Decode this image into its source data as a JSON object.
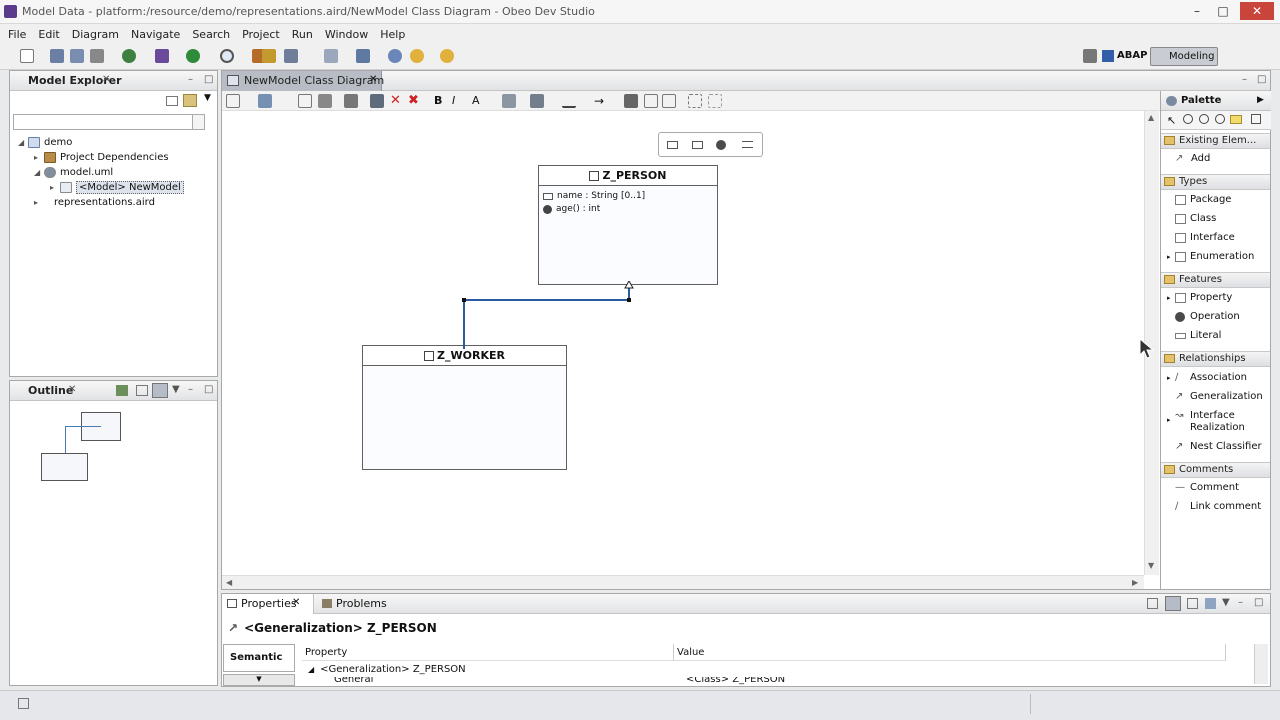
{
  "window": {
    "title": "Model Data - platform:/resource/demo/representations.aird/NewModel Class Diagram - Obeo Dev Studio"
  },
  "menu": [
    "File",
    "Edit",
    "Diagram",
    "Navigate",
    "Search",
    "Project",
    "Run",
    "Window",
    "Help"
  ],
  "perspectives": {
    "abap": "ABAP",
    "modeling": "Modeling"
  },
  "model_explorer": {
    "tab": "Model Explorer",
    "filter_placeholder": "",
    "tree": [
      {
        "label": "demo",
        "level": 0,
        "expanded": true
      },
      {
        "label": "Project Dependencies",
        "level": 1,
        "expanded": false
      },
      {
        "label": "model.uml",
        "level": 1,
        "expanded": true
      },
      {
        "label": "<Model> NewModel",
        "level": 2,
        "expanded": false,
        "selected": true
      },
      {
        "label": "representations.aird",
        "level": 1,
        "expanded": false
      }
    ]
  },
  "outline": {
    "tab": "Outline"
  },
  "editor": {
    "tab": "NewModel Class Diagram"
  },
  "diagram": {
    "person": {
      "title": "Z_PERSON",
      "attribute": "name : String [0..1]",
      "operation": "age() : int"
    },
    "worker": {
      "title": "Z_WORKER"
    }
  },
  "palette": {
    "title": "Palette",
    "sections": [
      {
        "name": "Existing Elem...",
        "items": [
          "Add"
        ]
      },
      {
        "name": "Types",
        "items": [
          "Package",
          "Class",
          "Interface",
          "Enumeration"
        ]
      },
      {
        "name": "Features",
        "items": [
          "Property",
          "Operation",
          "Literal"
        ]
      },
      {
        "name": "Relationships",
        "items": [
          "Association",
          "Generalization",
          "Interface Realization",
          "Nest Classifier"
        ]
      },
      {
        "name": "Comments",
        "items": [
          "Comment",
          "Link comment"
        ]
      }
    ]
  },
  "properties": {
    "tab": "Properties",
    "problems_tab": "Problems",
    "heading": "<Generalization> Z_PERSON",
    "side_tab": "Semantic",
    "columns": [
      "Property",
      "Value"
    ],
    "rows": [
      {
        "property": "<Generalization> Z_PERSON",
        "value": ""
      },
      {
        "property": "General",
        "value": "<Class> Z_PERSON"
      }
    ]
  }
}
